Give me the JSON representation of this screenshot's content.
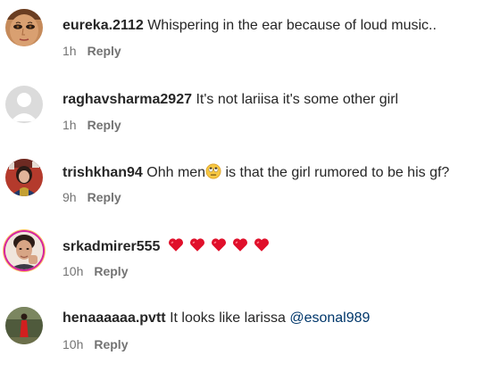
{
  "comments": [
    {
      "username": "eureka.2112",
      "text": "Whispering in the ear because of loud music..",
      "time": "1h",
      "reply_label": "Reply",
      "avatar_icon": "face-avatar-icon"
    },
    {
      "username": "raghavsharma2927",
      "text": "It's not lariisa it's some other girl",
      "time": "1h",
      "reply_label": "Reply",
      "avatar_icon": "default-avatar-icon"
    },
    {
      "username": "trishkhan94",
      "text_before": "Ohh men",
      "emoji": "eye-roll-emoji",
      "text_after": " is that the girl rumored to be his gf?",
      "time": "9h",
      "reply_label": "Reply",
      "avatar_icon": "woman-photo-avatar-icon"
    },
    {
      "username": "srkadmirer555",
      "hearts": [
        "red-heart-emoji",
        "red-heart-emoji",
        "red-heart-emoji",
        "red-heart-emoji",
        "red-heart-emoji"
      ],
      "time": "10h",
      "reply_label": "Reply",
      "avatar_icon": "man-photo-avatar-icon"
    },
    {
      "username": "henaaaaaa.pvtt",
      "text": "It looks like larissa ",
      "mention": "@esonal989",
      "time": "10h",
      "reply_label": "Reply",
      "avatar_icon": "woman-red-dress-avatar-icon"
    }
  ],
  "colors": {
    "text": "#262626",
    "secondary": "#737373",
    "mention": "#00376b",
    "heart": "#e0102b"
  }
}
